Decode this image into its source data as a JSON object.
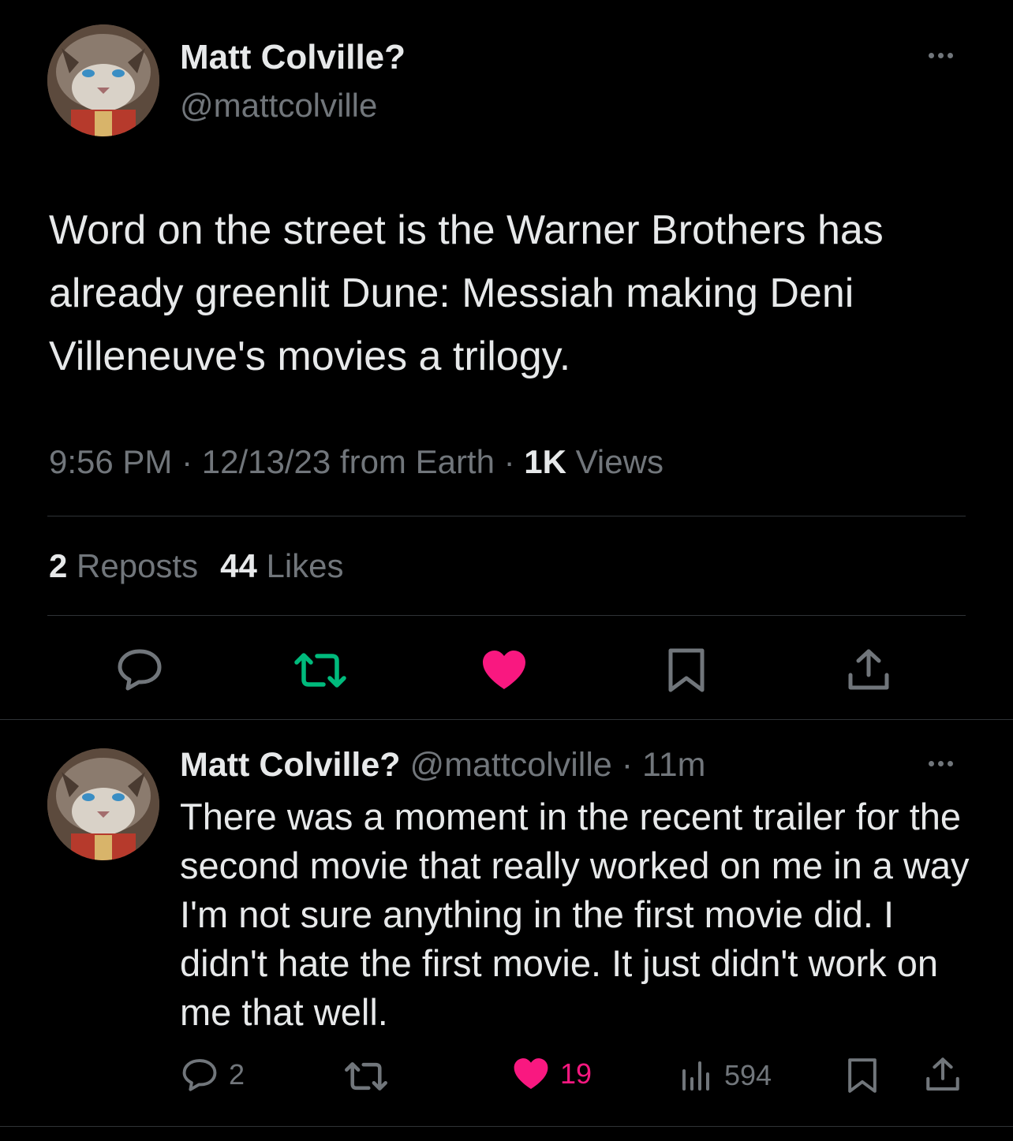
{
  "main_tweet": {
    "author_name": "Matt Colville?",
    "author_handle": "@mattcolville",
    "text": "Word on the street is the Warner Brothers has already greenlit Dune: Messiah making Deni Villeneuve's movies a trilogy.",
    "time": "9:56 PM",
    "sep1": " · ",
    "date": "12/13/23 from Earth",
    "sep2": " · ",
    "views_count": "1K",
    "views_label": " Views",
    "reposts_count": "2",
    "reposts_label": " Reposts",
    "likes_count": "44",
    "likes_label": " Likes"
  },
  "reply_tweet": {
    "author_name": "Matt Colville?",
    "author_handle": " @mattcolville",
    "separator": " · ",
    "time_ago": "11m",
    "text": "There was a moment in the recent trailer for the second movie that really worked on me in a way I'm not sure anything in the first movie did. I didn't hate the first movie. It just didn't work on me that well.",
    "reply_count": "2",
    "like_count": "19",
    "views_count": "594"
  },
  "icons": {
    "reply": "reply-icon",
    "repost": "repost-icon",
    "like": "heart-icon",
    "bookmark": "bookmark-icon",
    "share": "share-icon",
    "views": "views-icon",
    "more": "more-icon"
  },
  "colors": {
    "background": "#000000",
    "text_primary": "#e7e9ea",
    "text_secondary": "#71767b",
    "divider": "#2f3336",
    "repost_active": "#00ba7c",
    "like_active": "#f91880"
  }
}
